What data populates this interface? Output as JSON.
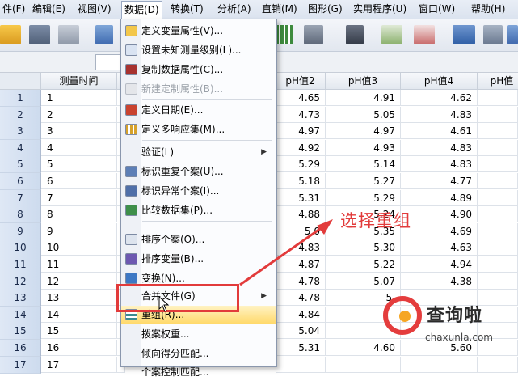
{
  "menubar": {
    "items": [
      "件(F)",
      "编辑(E)",
      "视图(V)",
      "数据(D)",
      "转换(T)",
      "分析(A)",
      "直销(M)",
      "图形(G)",
      "实用程序(U)",
      "窗口(W)",
      "帮助(H)"
    ]
  },
  "grid": {
    "headers": [
      "测量时间",
      "pH值2",
      "pH值3",
      "pH值4",
      "pH值"
    ],
    "rows": [
      {
        "n": "1",
        "t": "1",
        "p2": "4.65",
        "p3": "4.91",
        "p4": "4.62"
      },
      {
        "n": "2",
        "t": "2",
        "p2": "4.73",
        "p3": "5.05",
        "p4": "4.83"
      },
      {
        "n": "3",
        "t": "3",
        "p2": "4.97",
        "p3": "4.97",
        "p4": "4.61"
      },
      {
        "n": "4",
        "t": "4",
        "p2": "4.92",
        "p3": "4.93",
        "p4": "4.83"
      },
      {
        "n": "5",
        "t": "5",
        "p2": "5.29",
        "p3": "5.14",
        "p4": "4.83"
      },
      {
        "n": "6",
        "t": "6",
        "p2": "5.18",
        "p3": "5.27",
        "p4": "4.77"
      },
      {
        "n": "7",
        "t": "7",
        "p2": "5.31",
        "p3": "5.29",
        "p4": "4.89"
      },
      {
        "n": "8",
        "t": "8",
        "p2": "4.88",
        "p3": "5.24",
        "p4": "4.90"
      },
      {
        "n": "9",
        "t": "9",
        "p2": "5.0",
        "p3": "5.35",
        "p4": "4.69"
      },
      {
        "n": "10",
        "t": "10",
        "p2": "4.83",
        "p3": "5.30",
        "p4": "4.63"
      },
      {
        "n": "11",
        "t": "11",
        "p2": "4.87",
        "p3": "5.22",
        "p4": "4.94"
      },
      {
        "n": "12",
        "t": "12",
        "p2": "4.78",
        "p3": "5.07",
        "p4": "4.38"
      },
      {
        "n": "13",
        "t": "13",
        "p2": "4.78",
        "p3": "5.",
        "p4": ""
      },
      {
        "n": "14",
        "t": "14",
        "p2": "4.84",
        "p3": "",
        "p4": ""
      },
      {
        "n": "15",
        "t": "15",
        "p2": "5.04",
        "p3": "",
        "p4": ""
      },
      {
        "n": "16",
        "t": "16",
        "p2": "5.31",
        "p3": "4.60",
        "p4": "5.60"
      },
      {
        "n": "17",
        "t": "17",
        "p2": "",
        "p3": "",
        "p4": ""
      }
    ]
  },
  "dropdown": {
    "items": [
      {
        "label": "定义变量属性(V)..."
      },
      {
        "label": "设置未知测量级别(L)..."
      },
      {
        "label": "复制数据属性(C)..."
      },
      {
        "label": "新建定制属性(B)..."
      },
      {
        "label": "定义日期(E)..."
      },
      {
        "label": "定义多响应集(M)..."
      },
      {
        "label": "验证(L)"
      },
      {
        "label": "标识重复个案(U)..."
      },
      {
        "label": "标识异常个案(I)..."
      },
      {
        "label": "比较数据集(P)..."
      },
      {
        "label": "排序个案(O)..."
      },
      {
        "label": "排序变量(B)..."
      },
      {
        "label": "变换(N)..."
      },
      {
        "label": "合并文件(G)"
      },
      {
        "label": "重组(R)..."
      },
      {
        "label": "拨案权重..."
      },
      {
        "label": "倾向得分匹配..."
      },
      {
        "label": "个案控制匹配..."
      }
    ]
  },
  "annotation": {
    "text": "选择重组"
  },
  "watermark": {
    "title": "查询啦",
    "url": "chaxunla.com"
  },
  "colors": {
    "accent": "#e23b3b",
    "highlight": "#ffd96b"
  }
}
